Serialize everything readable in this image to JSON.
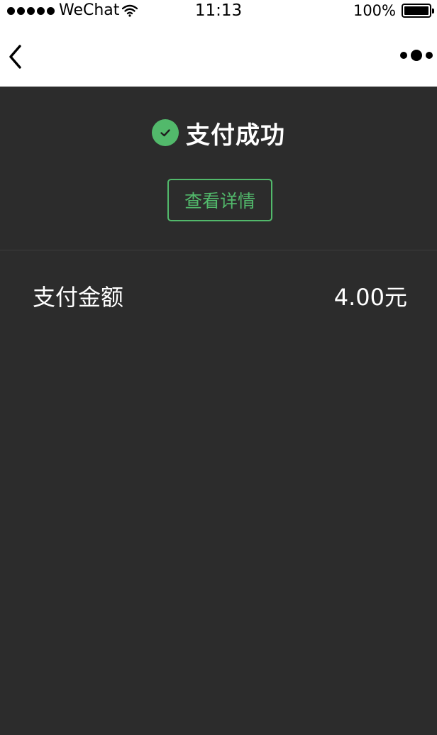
{
  "status_bar": {
    "carrier": "WeChat",
    "time": "11:13",
    "battery": "100%"
  },
  "nav": {
    "back_icon": "chevron-left-icon",
    "more_icon": "more-dots-icon"
  },
  "result": {
    "title": "支付成功",
    "icon": "check-circle-icon",
    "detail_button_label": "查看详情",
    "accent_color": "#52b96b"
  },
  "amount": {
    "label": "支付金额",
    "value": "4.00元"
  }
}
